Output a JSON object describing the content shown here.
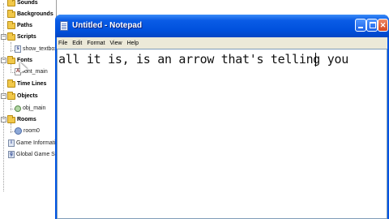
{
  "resource_tree": {
    "items": [
      {
        "label": "Sounds",
        "kind": "folder",
        "expanded": false
      },
      {
        "label": "Backgrounds",
        "kind": "folder",
        "expanded": false
      },
      {
        "label": "Paths",
        "kind": "folder",
        "expanded": false
      },
      {
        "label": "Scripts",
        "kind": "folder",
        "expanded": true
      },
      {
        "label": "show_textbox",
        "kind": "script"
      },
      {
        "label": "Fonts",
        "kind": "folder",
        "expanded": true
      },
      {
        "label": "font_main",
        "kind": "font",
        "selected": true
      },
      {
        "label": "Time Lines",
        "kind": "folder",
        "expanded": false
      },
      {
        "label": "Objects",
        "kind": "folder",
        "expanded": true
      },
      {
        "label": "obj_main",
        "kind": "object"
      },
      {
        "label": "Rooms",
        "kind": "folder",
        "expanded": true
      },
      {
        "label": "room0",
        "kind": "room"
      },
      {
        "label": "Game Information",
        "kind": "info"
      },
      {
        "label": "Global Game Settings",
        "kind": "settings"
      }
    ]
  },
  "notepad": {
    "title": "Untitled - Notepad",
    "menu": [
      "File",
      "Edit",
      "Format",
      "View",
      "Help"
    ],
    "content": "all it is, is an arrow that's telling you"
  },
  "colors": {
    "titlebar": "#0054e3",
    "menubar": "#ece9d8",
    "close_button": "#d5461e"
  }
}
